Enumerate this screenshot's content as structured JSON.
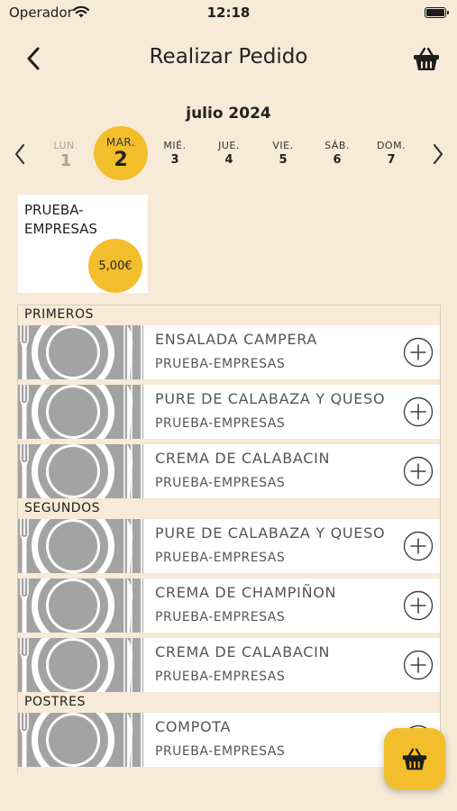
{
  "status_bar": {
    "carrier": "Operador",
    "time": "12:18"
  },
  "header": {
    "title": "Realizar Pedido"
  },
  "month_label": "julio 2024",
  "days": [
    {
      "name": "LUN.",
      "date": "1",
      "state": "disabled"
    },
    {
      "name": "MAR.",
      "date": "2",
      "state": "selected"
    },
    {
      "name": "MIÉ.",
      "date": "3",
      "state": "normal"
    },
    {
      "name": "JUE.",
      "date": "4",
      "state": "normal"
    },
    {
      "name": "VIE.",
      "date": "5",
      "state": "normal"
    },
    {
      "name": "SÁB.",
      "date": "6",
      "state": "normal"
    },
    {
      "name": "DOM.",
      "date": "7",
      "state": "normal"
    }
  ],
  "company": {
    "name": "PRUEBA-\nEMPRESAS",
    "price": "5,00€"
  },
  "sections": [
    {
      "title": "PRIMEROS",
      "items": [
        {
          "name": "ENSALADA CAMPERA",
          "company": "PRUEBA-EMPRESAS"
        },
        {
          "name": "PURE DE CALABAZA Y QUESO",
          "company": "PRUEBA-EMPRESAS"
        },
        {
          "name": "CREMA DE CALABACIN",
          "company": "PRUEBA-EMPRESAS"
        }
      ]
    },
    {
      "title": "SEGUNDOS",
      "items": [
        {
          "name": "PURE DE CALABAZA Y QUESO",
          "company": "PRUEBA-EMPRESAS"
        },
        {
          "name": "CREMA DE CHAMPIÑON",
          "company": "PRUEBA-EMPRESAS"
        },
        {
          "name": "CREMA DE CALABACIN",
          "company": "PRUEBA-EMPRESAS"
        }
      ]
    },
    {
      "title": "POSTRES",
      "items": [
        {
          "name": "COMPOTA",
          "company": "PRUEBA-EMPRESAS"
        }
      ]
    }
  ],
  "colors": {
    "background": "#f7ead7",
    "accent": "#f3be2c",
    "card": "#ffffff",
    "placeholder": "#a3a3a3"
  },
  "icons": {
    "back": "chevron-left-icon",
    "cart": "basket-icon",
    "prev": "chevron-left-icon",
    "next": "chevron-right-icon",
    "add": "plus-circle-icon",
    "dish": "plate-cutlery-icon"
  }
}
